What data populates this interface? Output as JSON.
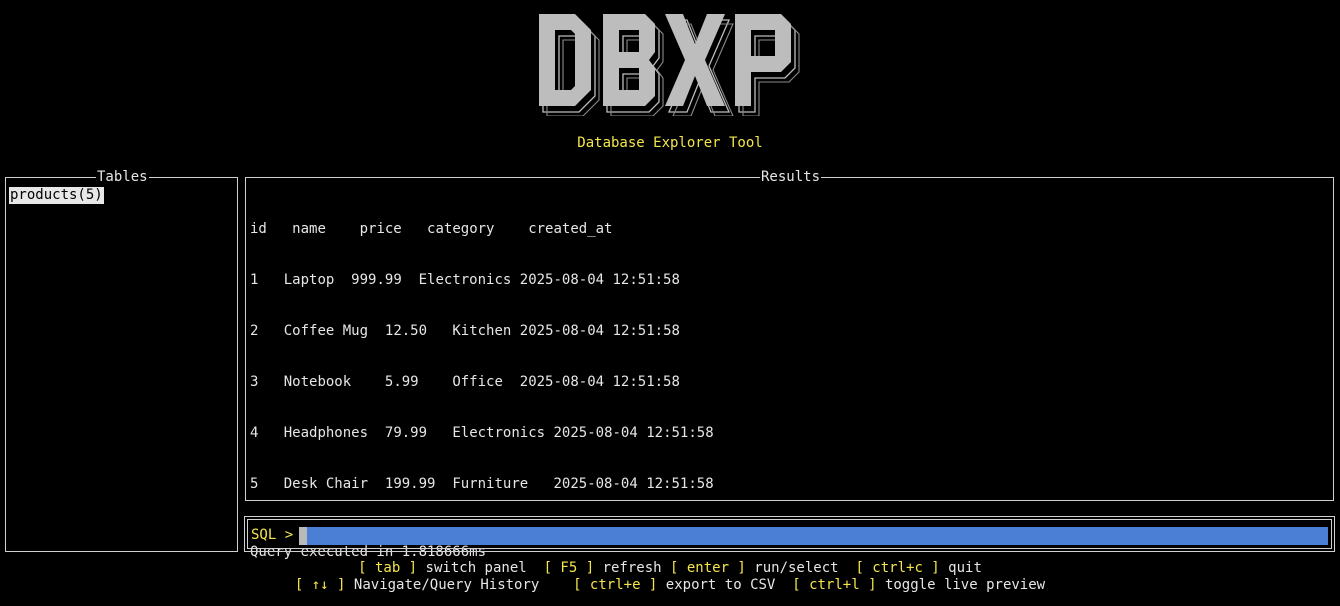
{
  "app": {
    "logo_text": "DBXP",
    "subtitle": "Database Explorer Tool"
  },
  "tables_panel": {
    "title": "Tables",
    "items": [
      {
        "label": "products(5)",
        "selected": true
      }
    ]
  },
  "results_panel": {
    "title": "Results",
    "columns": [
      "id",
      "name",
      "price",
      "category",
      "created_at"
    ],
    "rows": [
      [
        "1",
        "Laptop",
        "999.99",
        "Electronics",
        "2025-08-04 12:51:58"
      ],
      [
        "2",
        "Coffee Mug",
        "12.50",
        "Kitchen",
        "2025-08-04 12:51:58"
      ],
      [
        "3",
        "Notebook",
        "5.99",
        "Office",
        "2025-08-04 12:51:58"
      ],
      [
        "4",
        "Headphones",
        "79.99",
        "Electronics",
        "2025-08-04 12:51:58"
      ],
      [
        "5",
        "Desk Chair",
        "199.99",
        "Furniture",
        "2025-08-04 12:51:58"
      ]
    ],
    "status": "Query executed in 1.818666ms"
  },
  "sql_input": {
    "prompt": "SQL >",
    "value": ""
  },
  "help": {
    "line1": [
      {
        "key": "[ tab ]",
        "desc": " switch panel  "
      },
      {
        "key": "[ F5 ]",
        "desc": " refresh "
      },
      {
        "key": "[ enter ]",
        "desc": " run/select  "
      },
      {
        "key": "[ ctrl+c ]",
        "desc": " quit"
      }
    ],
    "line2": [
      {
        "key": "[ ↑↓ ]",
        "desc": " Navigate/Query History    "
      },
      {
        "key": "[ ctrl+e ]",
        "desc": " export to CSV  "
      },
      {
        "key": "[ ctrl+l ]",
        "desc": " toggle live preview"
      }
    ]
  },
  "colors": {
    "accent_yellow": "#f4e64b",
    "input_blue": "#4b7fd6",
    "selection_bg": "#e8e8e8"
  }
}
